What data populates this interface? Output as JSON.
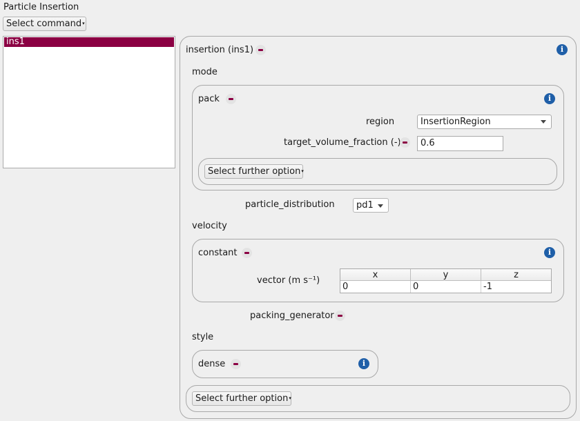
{
  "window": {
    "title": "Particle Insertion"
  },
  "toolbar": {
    "select_command_label": "Select command"
  },
  "list": {
    "items": [
      {
        "label": "ins1",
        "selected": true
      }
    ]
  },
  "insertion": {
    "header": "insertion (ins1)",
    "mode_label": "mode",
    "pack": {
      "header": "pack",
      "region_label": "region",
      "region_value": "InsertionRegion",
      "target_volume_fraction_label": "target_volume_fraction (-)",
      "target_volume_fraction_value": "0.6",
      "further_option_label": "Select further option"
    },
    "particle_distribution_label": "particle_distribution",
    "particle_distribution_value": "pd1",
    "velocity_label": "velocity",
    "constant": {
      "header": "constant",
      "vector_label": "vector (m s⁻¹)",
      "columns": [
        "x",
        "y",
        "z"
      ],
      "values": [
        "0",
        "0",
        "-1"
      ]
    },
    "packing_generator_label": "packing_generator",
    "style_label": "style",
    "dense": {
      "header": "dense"
    },
    "further_option_label": "Select further option"
  },
  "icons": {
    "info": "info-icon",
    "remove": "remove-icon",
    "dropdown": "chevron-down-icon"
  },
  "colors": {
    "accent": "#8b0043",
    "info": "#1f5fa8",
    "background": "#efefef"
  }
}
